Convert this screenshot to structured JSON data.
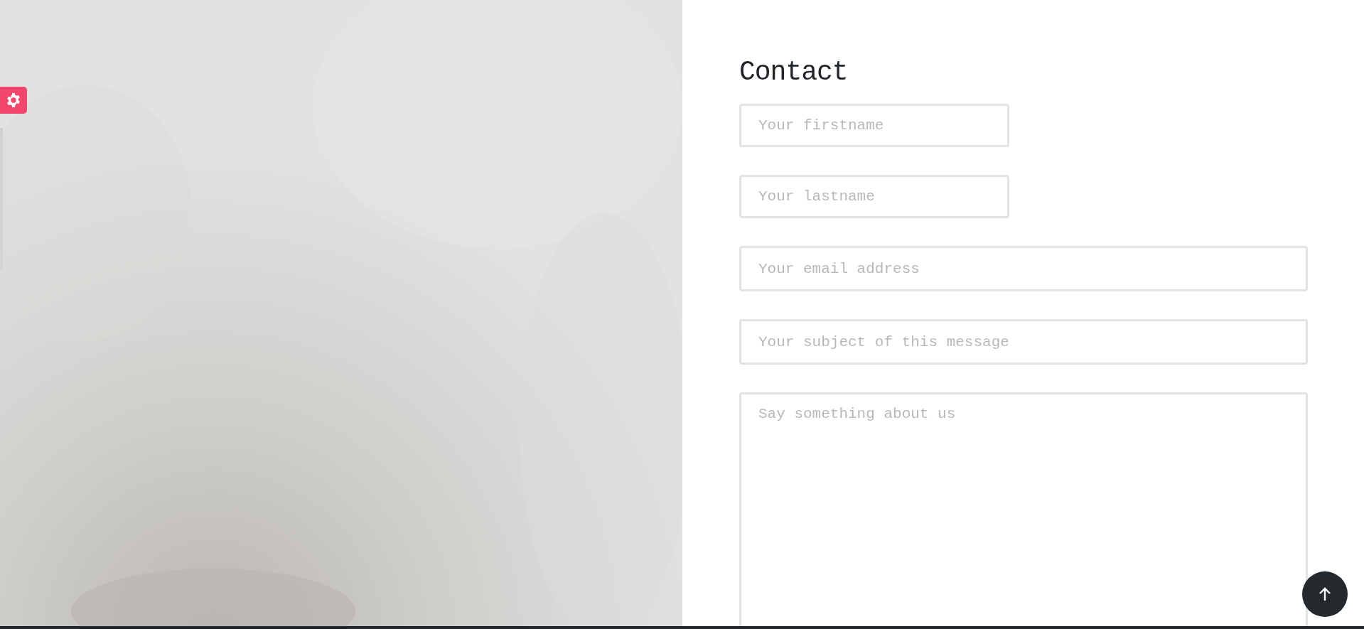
{
  "heading": "Contact",
  "fields": [
    {
      "kind": "short",
      "placeholder": "Your firstname"
    },
    {
      "kind": "short",
      "placeholder": "Your lastname"
    },
    {
      "kind": "wide",
      "placeholder": "Your email address"
    },
    {
      "kind": "wide",
      "placeholder": "Your subject of this message"
    },
    {
      "kind": "area",
      "placeholder": "Say something about us"
    }
  ]
}
